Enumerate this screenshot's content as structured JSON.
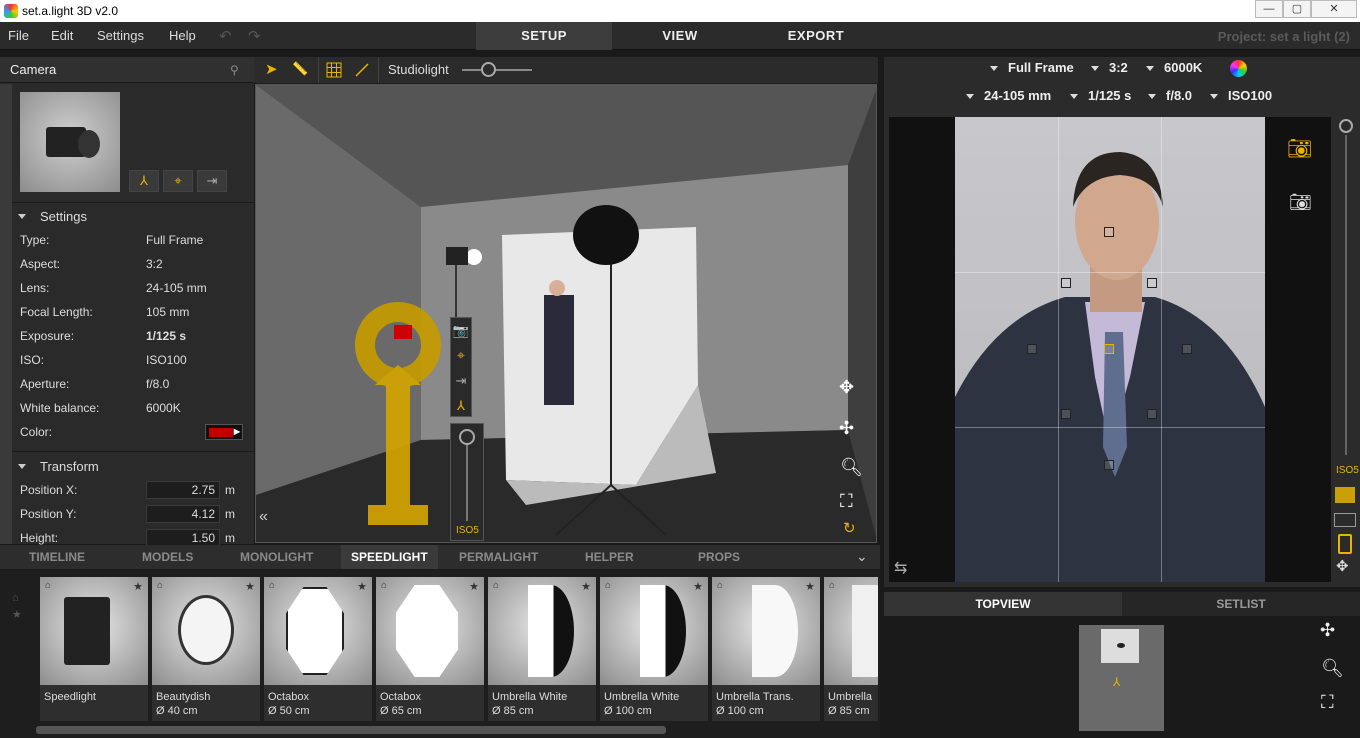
{
  "window": {
    "title": "set.a.light 3D v2.0",
    "min": "—",
    "max": "▢",
    "close": "✕"
  },
  "menu": {
    "file": "File",
    "edit": "Edit",
    "settings": "Settings",
    "help": "Help"
  },
  "modes": [
    "SETUP",
    "VIEW",
    "EXPORT"
  ],
  "active_mode": "SETUP",
  "project": "Project: set a light (2)",
  "camera_panel": {
    "title": "Camera",
    "settings_header": "Settings",
    "rows": [
      {
        "k": "Type:",
        "v": "Full Frame"
      },
      {
        "k": "Aspect:",
        "v": "3:2"
      },
      {
        "k": "Lens:",
        "v": "24-105 mm"
      },
      {
        "k": "Focal Length:",
        "v": "105 mm"
      },
      {
        "k": "Exposure:",
        "v": "1/125 s"
      },
      {
        "k": "ISO:",
        "v": "ISO100"
      },
      {
        "k": "Aperture:",
        "v": "f/8.0"
      },
      {
        "k": "White balance:",
        "v": "6000K"
      },
      {
        "k": "Color:",
        "v": ""
      }
    ],
    "color_value": "#c00000",
    "transform_header": "Transform",
    "transform": [
      {
        "k": "Position X:",
        "v": "2.75",
        "u": "m"
      },
      {
        "k": "Position Y:",
        "v": "4.12",
        "u": "m"
      },
      {
        "k": "Height:",
        "v": "1.50",
        "u": "m"
      }
    ]
  },
  "viewport_toolbar": {
    "light_mode": "Studiolight"
  },
  "viewport": {
    "iso_label": "ISO5"
  },
  "camera_bar": {
    "format": "Full Frame",
    "aspect": "3:2",
    "wb": "6000K",
    "lens": "24-105 mm",
    "shutter": "1/125 s",
    "aperture": "f/8.0",
    "iso": "ISO100"
  },
  "camera_side": {
    "iso_label": "ISO5"
  },
  "library_tabs": [
    "TIMELINE",
    "MODELS",
    "MONOLIGHT",
    "SPEEDLIGHT",
    "PERMALIGHT",
    "HELPER",
    "PROPS"
  ],
  "active_library_tab": "SPEEDLIGHT",
  "library_items": [
    {
      "name": "Speedlight",
      "size": ""
    },
    {
      "name": "Beautydish",
      "size": "Ø 40 cm"
    },
    {
      "name": "Octabox",
      "size": "Ø 50 cm"
    },
    {
      "name": "Octabox",
      "size": "Ø 65 cm"
    },
    {
      "name": "Umbrella White",
      "size": "Ø 85 cm"
    },
    {
      "name": "Umbrella White",
      "size": "Ø 100 cm"
    },
    {
      "name": "Umbrella Trans.",
      "size": "Ø 100 cm"
    },
    {
      "name": "Umbrella",
      "size": "Ø 85 cm"
    }
  ],
  "bottom_right_tabs": [
    "TOPVIEW",
    "SETLIST"
  ],
  "active_bottom_right_tab": "TOPVIEW",
  "accent": "#e8b400"
}
